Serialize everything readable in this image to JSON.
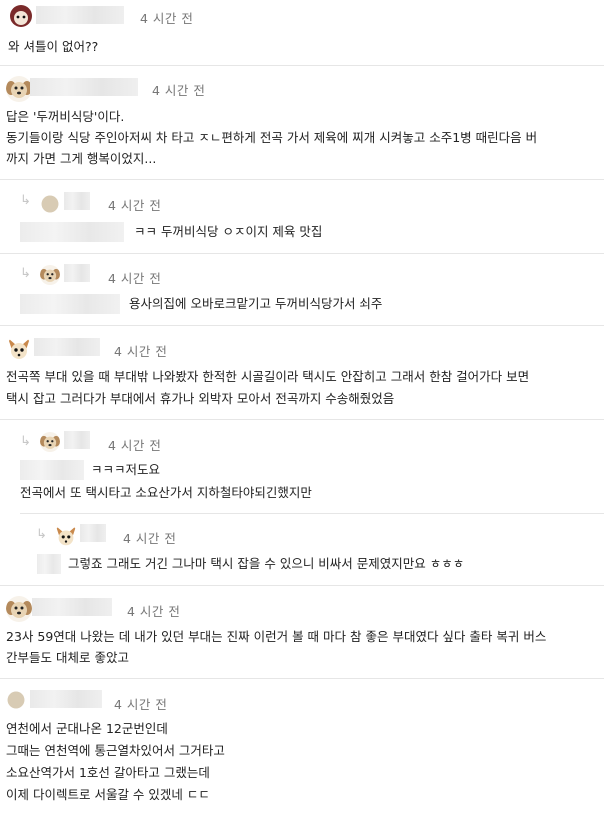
{
  "comments": [
    {
      "time": "4 시간 전",
      "avatar": "puppy-icon",
      "lines": [
        "와 셔틀이 없어??"
      ]
    },
    {
      "time": "4 시간 전",
      "avatar": "puppy-icon",
      "lines": [
        "답은 '두꺼비식당'이다.",
        "동기들이랑 식당 주인아저씨 차 타고 ㅈㄴ편하게 전곡 가서 제육에 찌개 시켜놓고 소주1병 때린다음 버",
        "까지 가면 그게 행복이었지..."
      ]
    },
    {
      "time": "4 시간 전",
      "avatar": "dot-icon",
      "reply": true,
      "lines": [
        "ㅋㅋ 두꺼비식당 ㅇㅈ이지 제육 맛집"
      ]
    },
    {
      "time": "4 시간 전",
      "avatar": "puppy-icon",
      "reply": true,
      "lines": [
        "용사의집에 오바로크맡기고 두꺼비식당가서 쇠주"
      ]
    },
    {
      "time": "4 시간 전",
      "avatar": "chihuahua-icon",
      "lines": [
        "전곡쪽 부대 있을 때 부대밖 나와봤자 한적한 시골길이라 택시도 안잡히고 그래서 한참 걸어가다 보면",
        "택시 잡고 그러다가 부대에서 휴가나 외박자 모아서 전곡까지 수송해줬었음"
      ]
    },
    {
      "time": "4 시간 전",
      "avatar": "puppy-icon",
      "reply": true,
      "lines": [
        "ㅋㅋㅋ저도요",
        "전곡에서 또 택시타고 소요산가서 지하철타야되긴했지만"
      ]
    },
    {
      "time": "4 시간 전",
      "avatar": "chihuahua-icon",
      "reply": true,
      "lines": [
        "그렇죠 그래도 거긴 그나마 택시 잡을 수 있으니 비싸서 문제였지만요 ㅎㅎㅎ"
      ]
    },
    {
      "time": "4 시간 전",
      "avatar": "puppy-icon",
      "lines": [
        "23사 59연대 나왔는 데 내가 있던 부대는 진짜 이런거 볼 때 마다 참 좋은 부대였다 싶다 출타 복귀 버스",
        "간부들도 대체로 좋았고"
      ]
    },
    {
      "time": "4 시간 전",
      "avatar": "dot-icon",
      "lines": [
        "연천에서 군대나온 12군번인데",
        "그때는 연천역에 통근열차있어서 그거타고",
        "소요산역가서 1호선 갈아타고 그랬는데",
        "이제 다이렉트로 서울갈 수 있겠네 ㄷㄷ"
      ]
    }
  ]
}
